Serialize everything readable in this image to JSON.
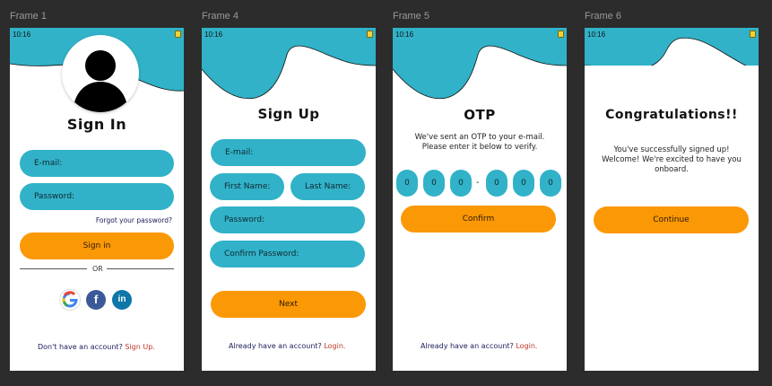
{
  "frames": [
    {
      "label": "Frame 1"
    },
    {
      "label": "Frame 4"
    },
    {
      "label": "Frame 5"
    },
    {
      "label": "Frame 6"
    }
  ],
  "status": {
    "time": "10:16"
  },
  "signin": {
    "title": "Sign In",
    "email_placeholder": "E-mail:",
    "password_placeholder": "Password:",
    "forgot": "Forgot your password?",
    "button": "Sign in",
    "or": "OR",
    "social": [
      "google-icon",
      "facebook-icon",
      "linkedin-icon"
    ],
    "footer_text": "Don't have an account?",
    "footer_link": "Sign Up."
  },
  "signup": {
    "title": "Sign Up",
    "email_placeholder": "E-mail:",
    "first_name_placeholder": "First Name:",
    "last_name_placeholder": "Last Name:",
    "password_placeholder": "Password:",
    "confirm_password_placeholder": "Confirm Password:",
    "button": "Next",
    "footer_text": "Already have an account?",
    "footer_link": "Login."
  },
  "otp": {
    "title": "OTP",
    "message_line1": "We've sent an OTP to your e-mail.",
    "message_line2": "Please enter it below to verify.",
    "digits": [
      "0",
      "0",
      "0",
      "0",
      "0",
      "0"
    ],
    "separator": "-",
    "button": "Confirm",
    "footer_text": "Already have an account?",
    "footer_link": "Login."
  },
  "congrats": {
    "title": "Congratulations!!",
    "message_line1": "You've successfully signed up!",
    "message_line2": "Welcome! We're excited to have you",
    "message_line3": "onboard.",
    "button": "Continue"
  },
  "colors": {
    "background": "#2c2c2c",
    "teal": "#31b2c8",
    "orange": "#fb9806",
    "link": "#c0392b"
  }
}
